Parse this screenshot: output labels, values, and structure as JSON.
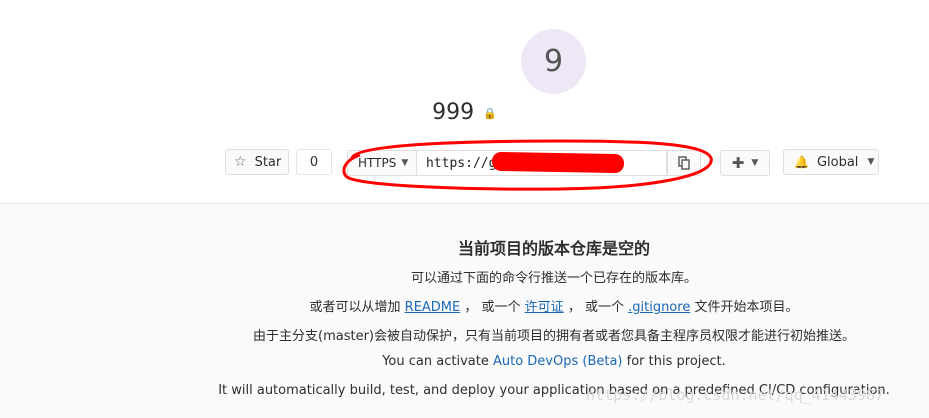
{
  "project": {
    "avatar_letter": "9",
    "name": "999",
    "visibility_icon": "lock-icon"
  },
  "actions": {
    "star_label": "Star",
    "star_count": "0",
    "clone_protocol": "HTTPS",
    "clone_url": "https://g                n/liu",
    "copy_icon": "clipboard-icon",
    "new_menu_icon": "plus-icon",
    "notification_label": "Global",
    "notification_icon": "bell-icon"
  },
  "empty_repo": {
    "heading": "当前项目的版本仓库是空的",
    "line1": "可以通过下面的命令行推送一个已存在的版本库。",
    "line2_prefix": "或者可以从增加",
    "line2_readme": "README",
    "line2_mid1": "， 或一个",
    "line2_license": "许可证",
    "line2_mid2": "， 或一个",
    "line2_gitignore": ".gitignore",
    "line2_suffix": "文件开始本项目。",
    "line3": "由于主分支(master)会被自动保护，只有当前项目的拥有者或者您具备主程序员权限才能进行初始推送。",
    "line4_prefix": "You can activate",
    "line4_link": "Auto DevOps (Beta)",
    "line4_suffix": "for this project.",
    "line5": "It will automatically build, test, and deploy your application based on a predefined CI/CD configuration."
  },
  "watermark": "https://blog.csdn.net/qq_41443987",
  "colors": {
    "link": "#1b69b6",
    "avatar_bg": "#eee8f6",
    "annotation": "#ff0000"
  }
}
